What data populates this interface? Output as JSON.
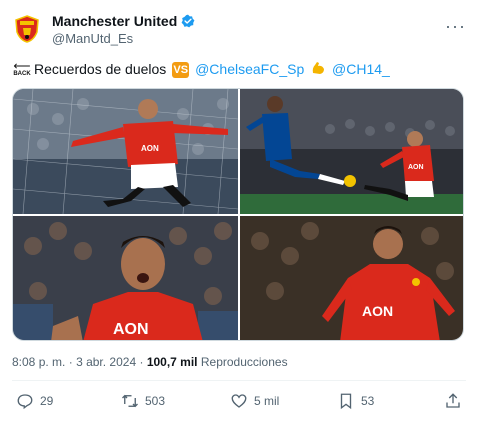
{
  "account": {
    "display_name": "Manchester United",
    "handle": "@ManUtd_Es",
    "avatar_icon": "manchester-united-crest",
    "verified_icon": "verified-badge-icon",
    "more_icon": "more-horizontal-icon"
  },
  "tweet": {
    "back_emoji_label": "BACK",
    "text": "Recuerdos de duelos",
    "vs_emoji_label": "VS",
    "mention_1": "@ChelseaFC_Sp",
    "mention_2": "@CH14_"
  },
  "media": {
    "photo_count": 4,
    "photo_1_icon": "photo-player-celebrating-icon",
    "photo_2_icon": "photo-player-volley-icon",
    "photo_3_icon": "photo-player-shouting-icon",
    "photo_4_icon": "photo-player-running-icon"
  },
  "timestamp": {
    "time": "8:08 p. m.",
    "separator": "·",
    "date": "3 abr. 2024",
    "views_count": "100,7 mil",
    "views_label": "Reproducciones"
  },
  "actions": {
    "replies": "29",
    "reposts": "503",
    "likes": "5 mil",
    "bookmarks": "53"
  },
  "colors": {
    "accent": "#1d9bf0",
    "united_red": "#da291c",
    "chelsea_blue": "#034694",
    "text_secondary": "#536471"
  }
}
